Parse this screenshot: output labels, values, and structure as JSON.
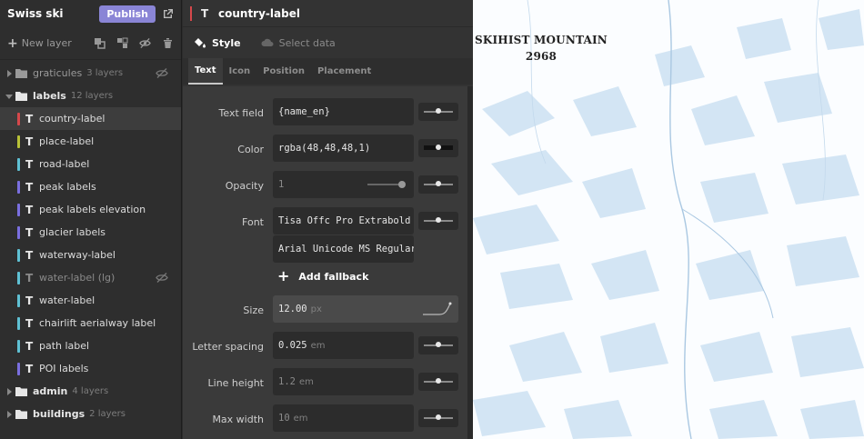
{
  "app": {
    "title": "Swiss ski",
    "publish_label": "Publish"
  },
  "toolbar": {
    "new_layer_label": "New layer"
  },
  "groups": {
    "graticules": {
      "name": "graticules",
      "count": "3 layers"
    },
    "labels": {
      "name": "labels",
      "count": "12 layers"
    },
    "admin": {
      "name": "admin",
      "count": "4 layers"
    },
    "buildings": {
      "name": "buildings",
      "count": "2 layers"
    }
  },
  "layers": [
    {
      "name": "country-label",
      "color": "#d6484b"
    },
    {
      "name": "place-label",
      "color": "#b8c237"
    },
    {
      "name": "road-label",
      "color": "#5fc1d4"
    },
    {
      "name": "peak labels",
      "color": "#7a6fe0"
    },
    {
      "name": "peak labels elevation",
      "color": "#7a6fe0"
    },
    {
      "name": "glacier labels",
      "color": "#7a6fe0"
    },
    {
      "name": "waterway-label",
      "color": "#5fc1d4"
    },
    {
      "name": "water-label (lg)",
      "color": "#5fc1d4"
    },
    {
      "name": "water-label",
      "color": "#5fc1d4"
    },
    {
      "name": "chairlift aerialway label",
      "color": "#5fc1d4"
    },
    {
      "name": "path label",
      "color": "#5fc1d4"
    },
    {
      "name": "POI labels",
      "color": "#7a6fe0"
    }
  ],
  "editor": {
    "layer_title": "country-label",
    "tabs": {
      "style": "Style",
      "select_data": "Select data"
    },
    "subtabs": {
      "text": "Text",
      "icon": "Icon",
      "position": "Position",
      "placement": "Placement"
    },
    "props": {
      "text_field": {
        "label": "Text field",
        "value": "{name_en}"
      },
      "color": {
        "label": "Color",
        "value": "rgba(48,48,48,1)"
      },
      "opacity": {
        "label": "Opacity",
        "value": "1"
      },
      "font": {
        "label": "Font",
        "value": "Tisa Offc Pro Extrabold",
        "fallback": "Arial Unicode MS Regular",
        "add_fallback": "Add fallback"
      },
      "size": {
        "label": "Size",
        "value": "12.00",
        "unit": "px"
      },
      "letter_spacing": {
        "label": "Letter spacing",
        "value": "0.025",
        "unit": "em"
      },
      "line_height": {
        "label": "Line height",
        "value": "1.2",
        "unit": "em"
      },
      "max_width": {
        "label": "Max width",
        "value": "10",
        "unit": "em"
      }
    }
  },
  "map": {
    "peak_name": "SKIHIST MOUNTAIN",
    "peak_elevation": "2968"
  },
  "colors": {
    "accent": "#8a85d6",
    "selected_swatch": "#d6484b",
    "map_background": "#fbfdff",
    "map_terrain": "#cfe3f3"
  }
}
